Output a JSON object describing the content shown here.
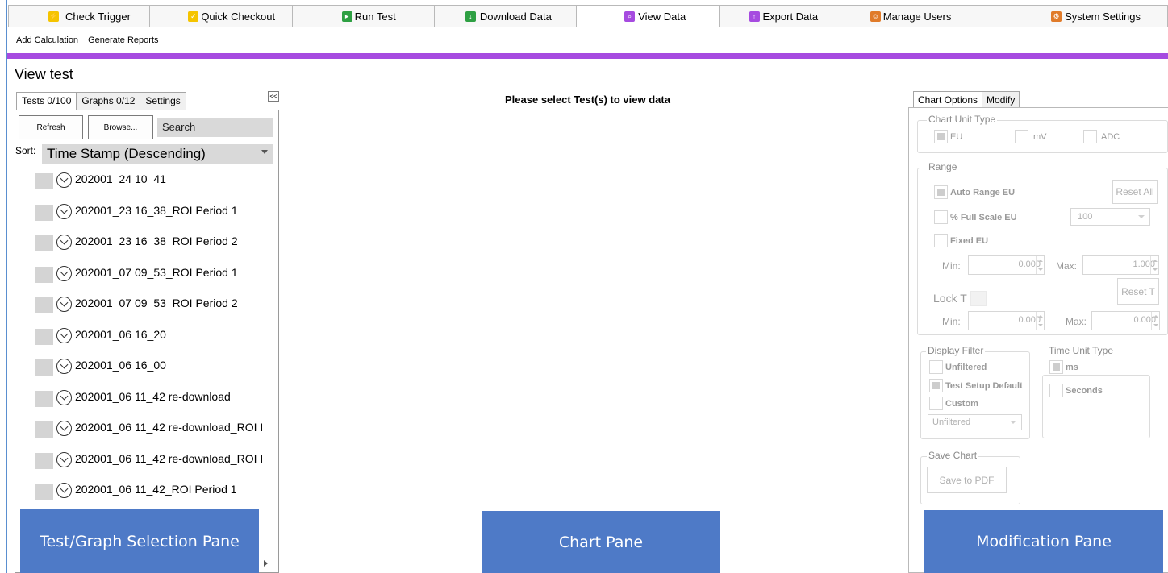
{
  "tabs": [
    {
      "label": "Check Trigger",
      "icon": "trigger-icon",
      "color": "#f5c400"
    },
    {
      "label": "Quick Checkout",
      "icon": "checkout-icon",
      "color": "#f5c400"
    },
    {
      "label": "Run Test",
      "icon": "run-icon",
      "color": "#2ea043"
    },
    {
      "label": "Download Data",
      "icon": "download-icon",
      "color": "#2ea043"
    },
    {
      "label": "View Data",
      "icon": "view-icon",
      "color": "#a64be0"
    },
    {
      "label": "Export Data",
      "icon": "export-icon",
      "color": "#a64be0"
    },
    {
      "label": "Manage Users",
      "icon": "users-icon",
      "color": "#e07b2a"
    },
    {
      "label": "System Settings",
      "icon": "settings-icon",
      "color": "#e07b2a"
    }
  ],
  "toolbar": {
    "add_calculation": "Add Calculation",
    "generate_reports": "Generate Reports"
  },
  "accent_color": "#a64be0",
  "page_title": "View test",
  "left": {
    "tabs": [
      "Tests 0/100",
      "Graphs 0/12",
      "Settings"
    ],
    "collapse": "<<",
    "refresh": "Refresh",
    "browse": "Browse...",
    "search_placeholder": "Search",
    "sort_label": "Sort:",
    "sort_value": "Time Stamp (Descending)",
    "tests": [
      "202001_24 10_41",
      "202001_23 16_38_ROI Period 1",
      "202001_23 16_38_ROI Period 2",
      "202001_07 09_53_ROI Period 1",
      "202001_07 09_53_ROI Period 2",
      "202001_06 16_20",
      "202001_06 16_00",
      "202001_06 11_42 re-download",
      "202001_06 11_42 re-download_ROI I",
      "202001_06 11_42 re-download_ROI I",
      "202001_06 11_42_ROI Period 1"
    ],
    "pane_label": "Test/Graph Selection Pane"
  },
  "center": {
    "message": "Please select Test(s) to view data",
    "pane_label": "Chart Pane"
  },
  "right": {
    "tabs": [
      "Chart Options",
      "Modify"
    ],
    "chart_unit_type": {
      "title": "Chart Unit Type",
      "eu": "EU",
      "mv": "mV",
      "adc": "ADC"
    },
    "range": {
      "title": "Range",
      "auto_range": "Auto Range EU",
      "reset_all": "Reset All",
      "full_scale": "% Full Scale EU",
      "full_scale_value": "100",
      "fixed": "Fixed EU",
      "min_label": "Min:",
      "max_label": "Max:",
      "min1": "0.000",
      "max1": "1.000",
      "lock_t": "Lock T",
      "reset_t": "Reset T",
      "min2": "0.000",
      "max2": "0.000"
    },
    "display_filter": {
      "title": "Display Filter",
      "unfiltered": "Unfiltered",
      "test_setup_default": "Test Setup Default",
      "custom": "Custom",
      "dropdown": "Unfiltered"
    },
    "time_unit": {
      "title": "Time Unit Type",
      "ms": "ms",
      "seconds": "Seconds"
    },
    "save_chart": {
      "title": "Save Chart",
      "button": "Save to PDF"
    },
    "pane_label": "Modification Pane"
  }
}
